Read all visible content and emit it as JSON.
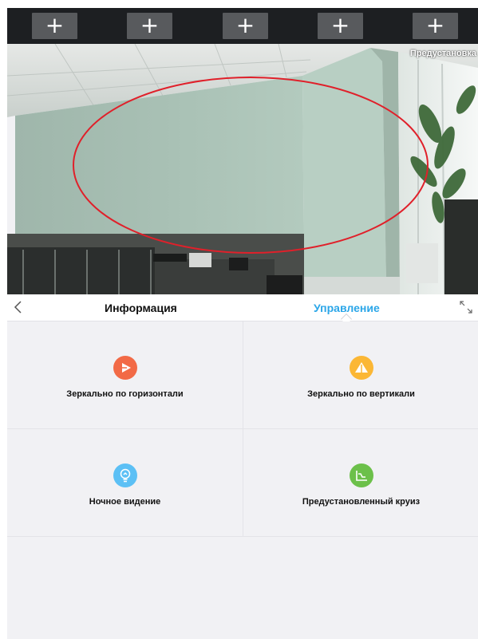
{
  "preset_bar": {
    "buttons": [
      "+",
      "+",
      "+",
      "+",
      "+"
    ]
  },
  "video": {
    "preset_caption": "Предустановка"
  },
  "tabs": {
    "info": "Информация",
    "control": "Управление"
  },
  "controls": [
    {
      "label": "Зеркально по горизонтали",
      "icon": "play-triangle-icon",
      "color": "#f26a46"
    },
    {
      "label": "Зеркально по вертикали",
      "icon": "warning-triangle-icon",
      "color": "#fbb735"
    },
    {
      "label": "Ночное видение",
      "icon": "lightbulb-icon",
      "color": "#5cc0f5"
    },
    {
      "label": "Предустановленный круиз",
      "icon": "route-icon",
      "color": "#6cc04a"
    }
  ],
  "colors": {
    "accent": "#2aa6e8",
    "highlight_ellipse": "#e0202a"
  }
}
